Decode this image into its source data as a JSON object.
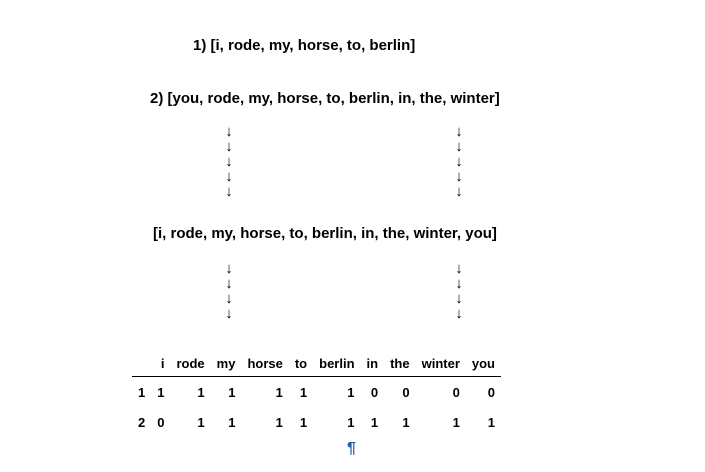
{
  "sentences": {
    "line1": "1) [i, rode, my, horse, to, berlin]",
    "line2": "2) [you, rode, my, horse, to, berlin, in, the, winter]",
    "vocabulary": "[i, rode, my, horse, to, berlin, in, the, winter, you]"
  },
  "arrow_glyph": "↓",
  "table": {
    "columns": [
      "",
      "i",
      "rode",
      "my",
      "horse",
      "to",
      "berlin",
      "in",
      "the",
      "winter",
      "you"
    ],
    "rows": [
      [
        "1",
        "1",
        "1",
        "1",
        "1",
        "1",
        "1",
        "0",
        "0",
        "0",
        "0"
      ],
      [
        "2",
        "0",
        "1",
        "1",
        "1",
        "1",
        "1",
        "1",
        "1",
        "1",
        "1"
      ]
    ]
  },
  "pilcrow": "¶"
}
